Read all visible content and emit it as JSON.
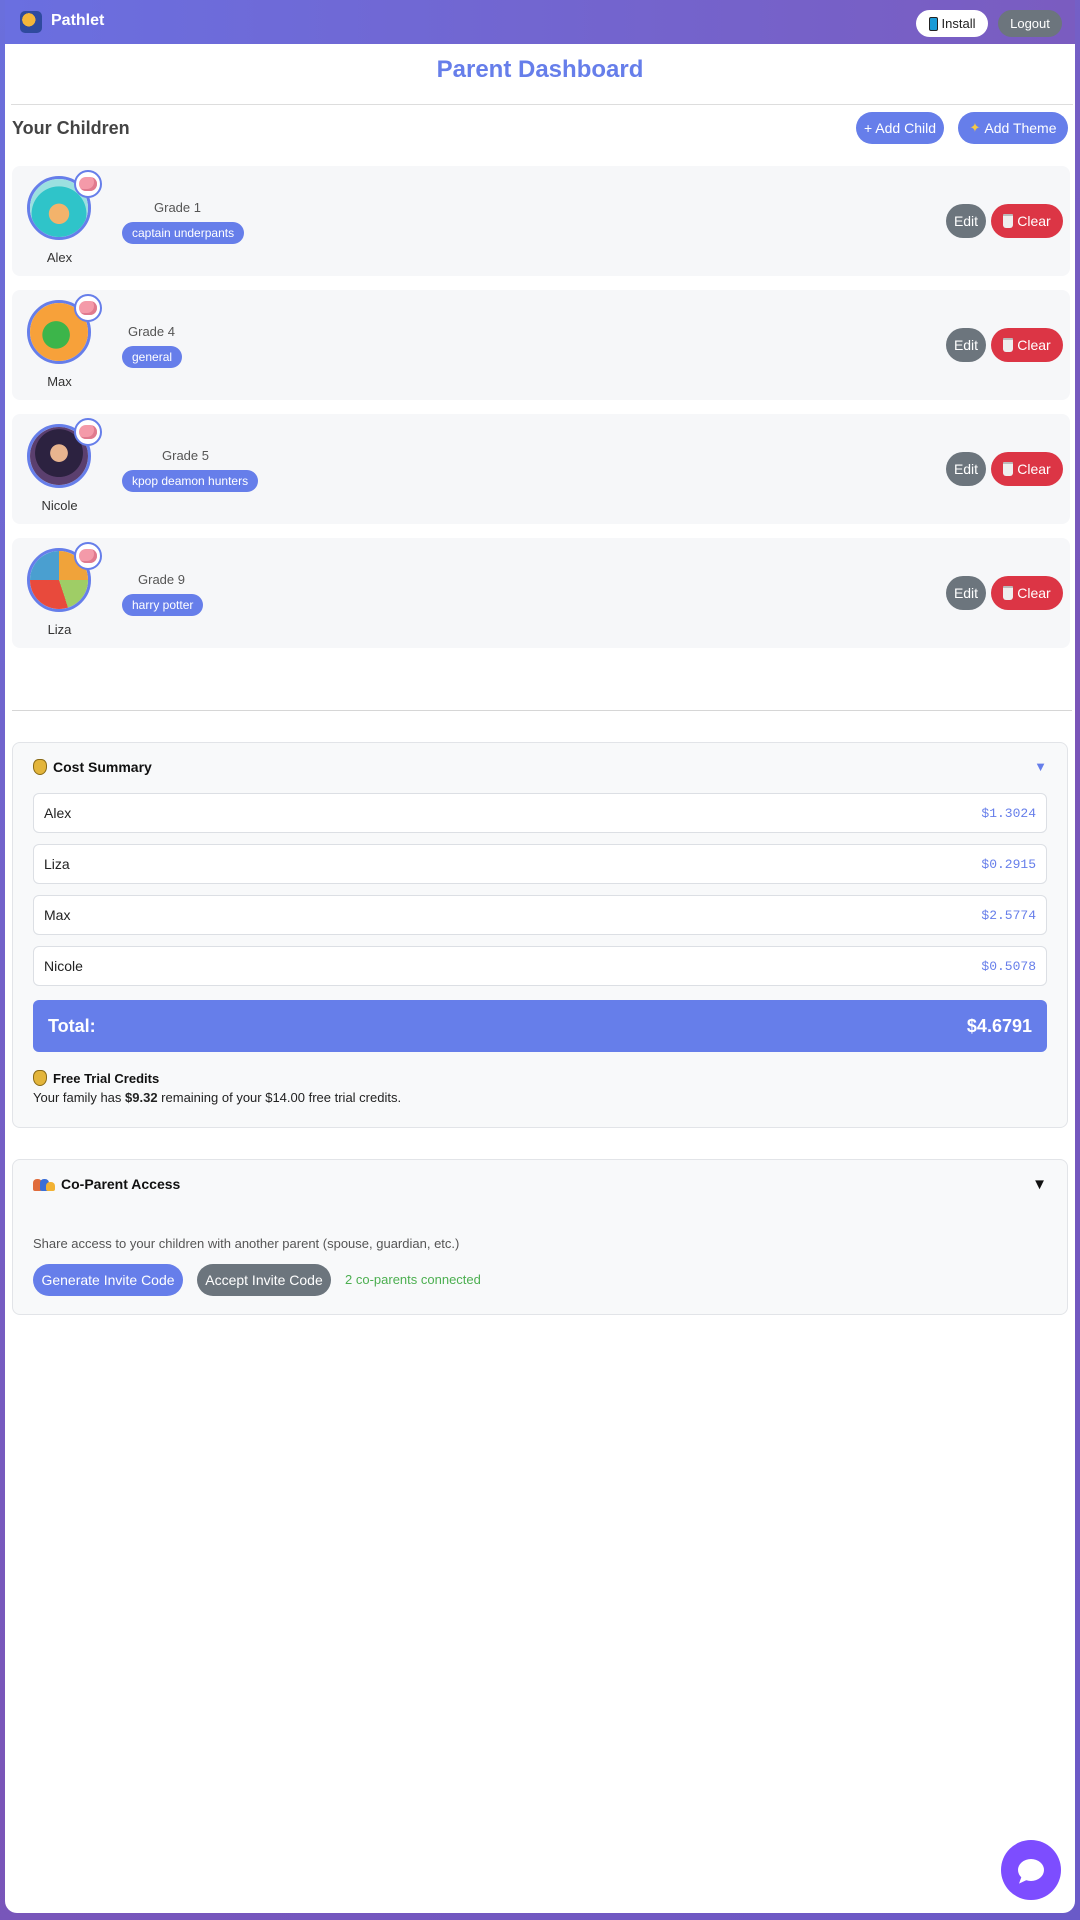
{
  "app": {
    "name": "Pathlet"
  },
  "header": {
    "install_label": "Install",
    "logout_label": "Logout"
  },
  "page": {
    "title": "Parent Dashboard"
  },
  "children_section": {
    "heading": "Your Children",
    "add_child_label": "+ Add Child",
    "add_theme_label": "Add Theme",
    "edit_label": "Edit",
    "clear_label": "Clear",
    "children": [
      {
        "name": "Alex",
        "grade": "Grade 1",
        "theme": "captain underpants"
      },
      {
        "name": "Max",
        "grade": "Grade 4",
        "theme": "general"
      },
      {
        "name": "Nicole",
        "grade": "Grade 5",
        "theme": "kpop deamon hunters"
      },
      {
        "name": "Liza",
        "grade": "Grade 9",
        "theme": "harry potter"
      }
    ]
  },
  "cost_summary": {
    "title": "Cost Summary",
    "rows": [
      {
        "name": "Alex",
        "amount": "$1.3024"
      },
      {
        "name": "Liza",
        "amount": "$0.2915"
      },
      {
        "name": "Max",
        "amount": "$2.5774"
      },
      {
        "name": "Nicole",
        "amount": "$0.5078"
      }
    ],
    "total_label": "Total:",
    "total_value": "$4.6791",
    "credits_title": "Free Trial Credits",
    "credits_prefix": "Your family has ",
    "credits_amount": "$9.32",
    "credits_suffix": " remaining of your $14.00 free trial credits."
  },
  "coparent": {
    "title": "Co-Parent Access",
    "description": "Share access to your children with another parent (spouse, guardian, etc.)",
    "generate_label": "Generate Invite Code",
    "accept_label": "Accept Invite Code",
    "status": "2 co-parents connected"
  },
  "colors": {
    "accent": "#667eea",
    "danger": "#dc3545",
    "secondary": "#6c757d",
    "success": "#4caf50"
  }
}
